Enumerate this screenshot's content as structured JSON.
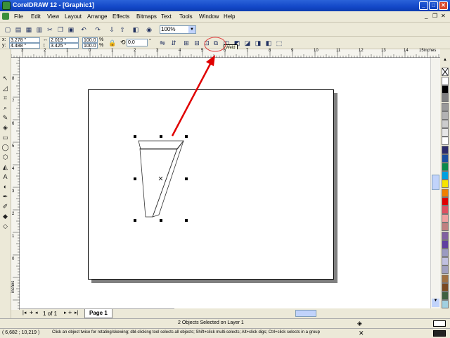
{
  "window": {
    "title": "CorelDRAW 12 - [Graphic1]"
  },
  "menu": [
    "File",
    "Edit",
    "View",
    "Layout",
    "Arrange",
    "Effects",
    "Bitmaps",
    "Text",
    "Tools",
    "Window",
    "Help"
  ],
  "toolbar": {
    "zoom": "100%"
  },
  "property_bar": {
    "x": "3.278 \"",
    "y": "4.488 \"",
    "width": "2.019 \"",
    "height": "3.425 \"",
    "scale_x": "100.0",
    "scale_y": "100.0",
    "pct": "%",
    "rotation": "0,0",
    "degree": "°",
    "tooltip": "Weld"
  },
  "ruler": {
    "h_ticks": [
      "3",
      "2",
      "1",
      "0",
      "1",
      "2",
      "3",
      "4",
      "5",
      "6",
      "7",
      "8",
      "9",
      "10",
      "11",
      "12",
      "13",
      "14",
      "15"
    ],
    "h_unit": "inches",
    "v_ticks": [
      "8",
      "7",
      "6",
      "5",
      "4",
      "3",
      "2",
      "1",
      "0"
    ],
    "v_unit": "inches"
  },
  "page_nav": {
    "counter": "1 of 1",
    "tab": "Page 1"
  },
  "status": {
    "selection": "2 Objects Selected on Layer 1",
    "coords": "( 6,682 ; 10,219 )",
    "hint": "Click an object twice for rotating/skewing; dbl-clicking tool selects all objects; Shift+click multi-selects; Alt+click digs; Ctrl+click selects in a group"
  },
  "colors": {
    "titlebar": "#1348c8",
    "annotation": "#e00000",
    "page_shadow": "#808080"
  },
  "palette": [
    "#ffffff",
    "#000000",
    "#808080",
    "#999999",
    "#b3b3b3",
    "#cccccc",
    "#e6e6e6",
    "#ffffff",
    "#2b2b6b",
    "#1a4fa0",
    "#0a8a4a",
    "#00a0e0",
    "#f6e400",
    "#f08000",
    "#e00000",
    "#e05060",
    "#f0a0a0",
    "#c08080",
    "#8060a0",
    "#6040a0",
    "#9a9ac0",
    "#c0c0e0",
    "#a0a0c0",
    "#a07040",
    "#7a4a20",
    "#406040",
    "#a0d0e0"
  ]
}
